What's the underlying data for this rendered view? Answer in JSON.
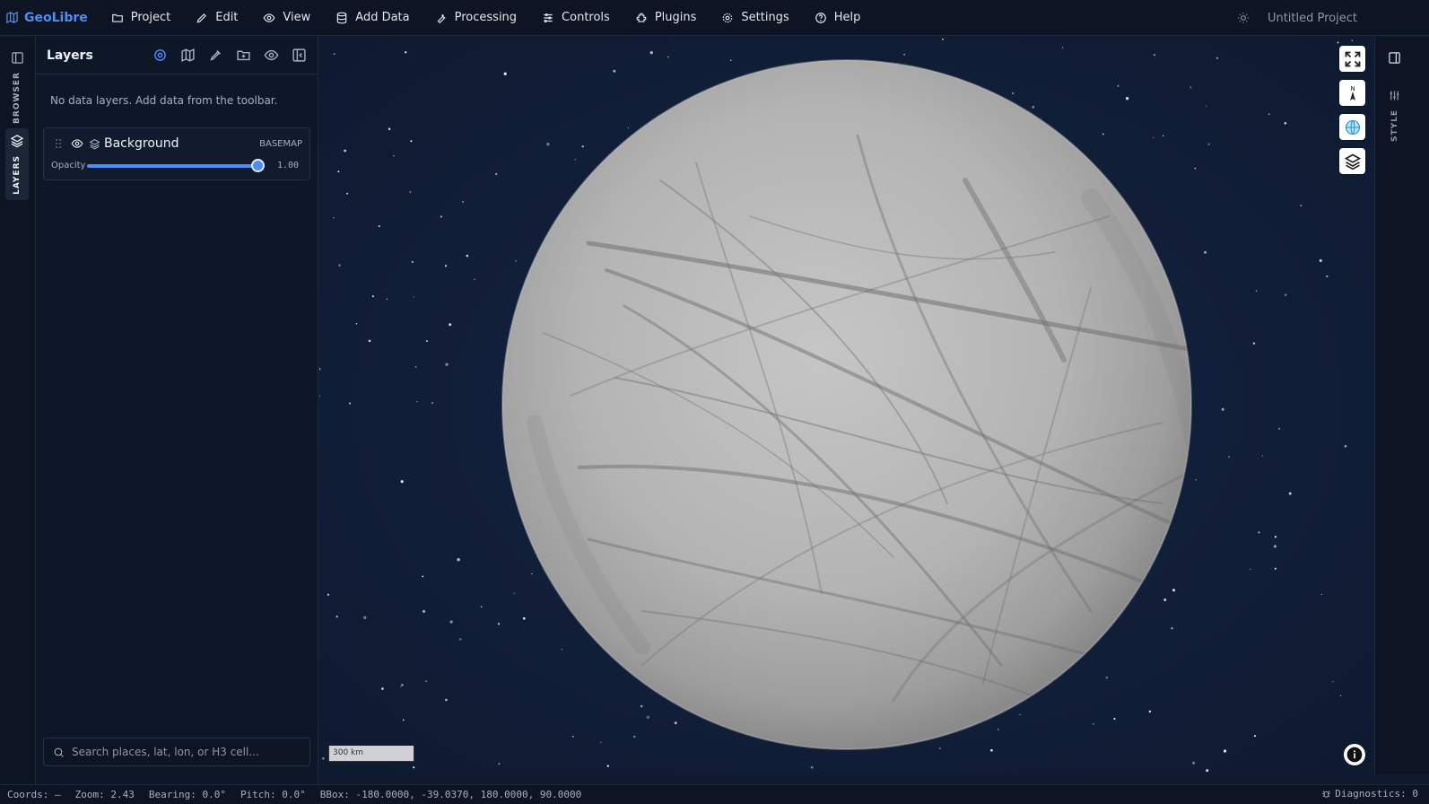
{
  "app": {
    "brand": "GeoLibre",
    "project_name": "Untitled Project"
  },
  "menu": [
    {
      "label": "Project",
      "icon": "folder-icon"
    },
    {
      "label": "Edit",
      "icon": "pencil-icon"
    },
    {
      "label": "View",
      "icon": "eye-icon"
    },
    {
      "label": "Add Data",
      "icon": "database-icon"
    },
    {
      "label": "Processing",
      "icon": "wrench-icon"
    },
    {
      "label": "Controls",
      "icon": "sliders-icon"
    },
    {
      "label": "Plugins",
      "icon": "puzzle-icon"
    },
    {
      "label": "Settings",
      "icon": "gear-icon"
    },
    {
      "label": "Help",
      "icon": "help-circle-icon"
    }
  ],
  "left_rail": {
    "browser_label": "BROWSER",
    "layers_label": "LAYERS"
  },
  "layers_panel": {
    "title": "Layers",
    "empty_message": "No data layers. Add data from the toolbar.",
    "layers": [
      {
        "name": "Background",
        "badge": "BASEMAP",
        "opacity_label": "Opacity",
        "opacity": 1.0,
        "opacity_text": "1.00"
      }
    ],
    "search_placeholder": "Search places, lat, lon, or H3 cell..."
  },
  "map": {
    "scale_label": "300 km",
    "compass_label": "N"
  },
  "right_rail": {
    "style_label": "STYLE"
  },
  "status": {
    "coords": "Coords: —",
    "zoom": "Zoom: 2.43",
    "bearing": "Bearing: 0.0°",
    "pitch": "Pitch: 0.0°",
    "bbox": "BBox: -180.0000, -39.0370, 180.0000, 90.0000",
    "diagnostics": "Diagnostics: 0"
  },
  "colors": {
    "accent": "#4f8df7",
    "background": "#0f1a2e",
    "panel": "#0e1728"
  }
}
